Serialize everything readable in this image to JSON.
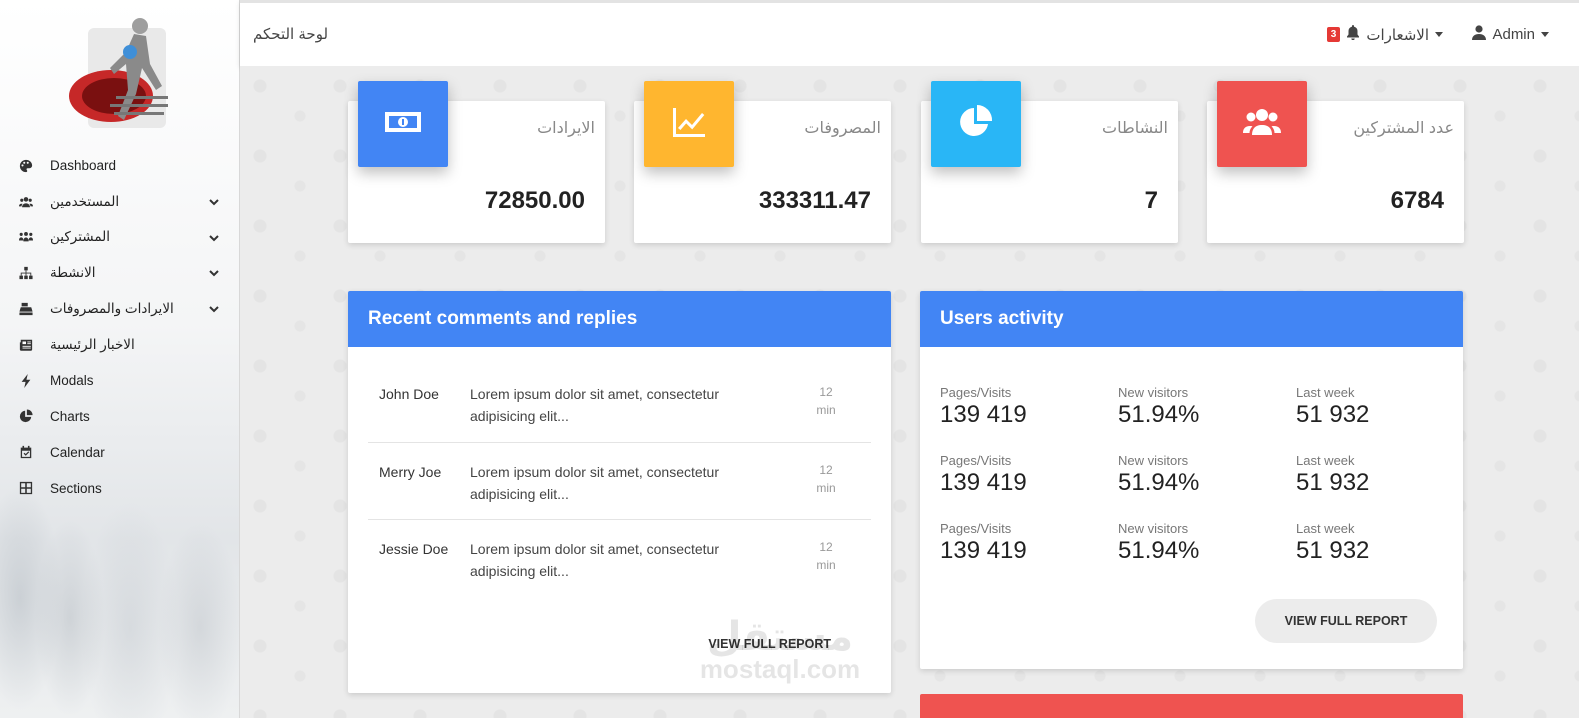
{
  "sidebar": {
    "items": [
      {
        "label": "Dashboard",
        "icon": "palette-icon",
        "has_submenu": false
      },
      {
        "label": "المستخدمين",
        "icon": "users-icon",
        "has_submenu": true
      },
      {
        "label": "المشتركين",
        "icon": "users-group-icon",
        "has_submenu": true
      },
      {
        "label": "الانشطة",
        "icon": "sitemap-icon",
        "has_submenu": true
      },
      {
        "label": "الايرادات والمصروفات",
        "icon": "cash-register-icon",
        "has_submenu": true
      },
      {
        "label": "الاخبار الرئيسية",
        "icon": "newspaper-icon",
        "has_submenu": false
      },
      {
        "label": "Modals",
        "icon": "bolt-icon",
        "has_submenu": false
      },
      {
        "label": "Charts",
        "icon": "pie-chart-icon",
        "has_submenu": false
      },
      {
        "label": "Calendar",
        "icon": "calendar-check-icon",
        "has_submenu": false
      },
      {
        "label": "Sections",
        "icon": "grid-icon",
        "has_submenu": false
      }
    ]
  },
  "topbar": {
    "title": "لوحة التحكم",
    "notifications_label": "الاشعارات",
    "notifications_count": "3",
    "user_label": "Admin"
  },
  "stats": [
    {
      "label": "الايرادات",
      "value": "72850.00",
      "color": "#4285f4",
      "icon": "money-bill-icon"
    },
    {
      "label": "المصروفات",
      "value": "333311.47",
      "color": "#ffb62f",
      "icon": "line-chart-icon"
    },
    {
      "label": "النشاطات",
      "value": "7",
      "color": "#29b6f6",
      "icon": "pie-chart-icon"
    },
    {
      "label": "عدد المشتركين",
      "value": "6784",
      "color": "#ef5350",
      "icon": "users-icon"
    }
  ],
  "comments": {
    "title": "Recent comments and replies",
    "rows": [
      {
        "name": "John Doe",
        "text": "Lorem ipsum dolor sit amet, consectetur adipisicing elit...",
        "time_value": "12",
        "time_unit": "min"
      },
      {
        "name": "Merry Joe",
        "text": "Lorem ipsum dolor sit amet, consectetur adipisicing elit...",
        "time_value": "12",
        "time_unit": "min"
      },
      {
        "name": "Jessie Doe",
        "text": "Lorem ipsum dolor sit amet, consectetur adipisicing elit...",
        "time_value": "12",
        "time_unit": "min"
      }
    ],
    "button": "VIEW FULL REPORT"
  },
  "activity": {
    "title": "Users activity",
    "rows": [
      [
        {
          "label": "Pages/Visits",
          "value": "139 419"
        },
        {
          "label": "New visitors",
          "value": "51.94%"
        },
        {
          "label": "Last week",
          "value": "51 932"
        }
      ],
      [
        {
          "label": "Pages/Visits",
          "value": "139 419"
        },
        {
          "label": "New visitors",
          "value": "51.94%"
        },
        {
          "label": "Last week",
          "value": "51 932"
        }
      ],
      [
        {
          "label": "Pages/Visits",
          "value": "139 419"
        },
        {
          "label": "New visitors",
          "value": "51.94%"
        },
        {
          "label": "Last week",
          "value": "51 932"
        }
      ]
    ],
    "button": "VIEW FULL REPORT"
  },
  "watermark": {
    "arabic": "مستقل",
    "latin": "mostaql.com"
  },
  "colors": {
    "primary": "#4285f4",
    "danger": "#ef5350",
    "warning": "#ffb62f",
    "info": "#29b6f6"
  }
}
